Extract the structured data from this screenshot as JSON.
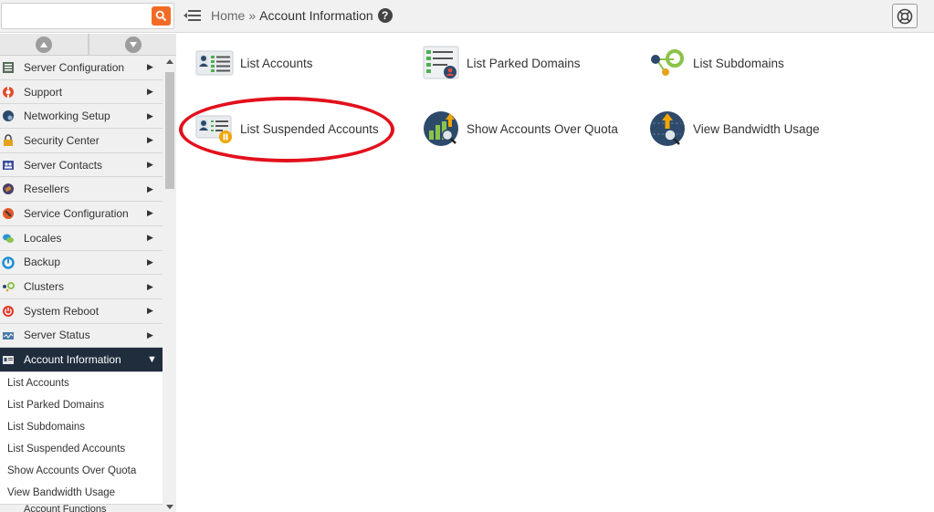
{
  "search": {
    "placeholder": "",
    "value": ""
  },
  "breadcrumb": {
    "home": "Home",
    "separator": "»",
    "current": "Account Information"
  },
  "sidebar": {
    "items": [
      {
        "label": "Server Configuration",
        "icon": "server-config-icon",
        "color": "#5a6a5a"
      },
      {
        "label": "Support",
        "icon": "lifebuoy-icon",
        "color": "#e34b2c"
      },
      {
        "label": "Networking Setup",
        "icon": "network-icon",
        "color": "#2e4a6b"
      },
      {
        "label": "Security Center",
        "icon": "lock-icon",
        "color": "#e5a21c"
      },
      {
        "label": "Server Contacts",
        "icon": "contacts-icon",
        "color": "#3d4fa0"
      },
      {
        "label": "Resellers",
        "icon": "tag-icon",
        "color": "#c9862c"
      },
      {
        "label": "Service Configuration",
        "icon": "wrench-icon",
        "color": "#e0582a"
      },
      {
        "label": "Locales",
        "icon": "speech-bubbles-icon",
        "color": "#2a98cf"
      },
      {
        "label": "Backup",
        "icon": "backup-icon",
        "color": "#1f8fd6"
      },
      {
        "label": "Clusters",
        "icon": "cluster-icon",
        "color": "#8bc34a"
      },
      {
        "label": "System Reboot",
        "icon": "power-icon",
        "color": "#e0392a"
      },
      {
        "label": "Server Status",
        "icon": "monitor-icon",
        "color": "#4a7aa8"
      },
      {
        "label": "Account Information",
        "icon": "account-info-icon",
        "color": "#ffffff"
      }
    ],
    "sub_items": [
      "List Accounts",
      "List Parked Domains",
      "List Subdomains",
      "List Suspended Accounts",
      "Show Accounts Over Quota",
      "View Bandwidth Usage"
    ],
    "next_item_peek": "Account Functions"
  },
  "tiles": [
    {
      "label": "List Accounts",
      "icon": "list-accounts-icon"
    },
    {
      "label": "List Parked Domains",
      "icon": "parked-domains-icon"
    },
    {
      "label": "List Subdomains",
      "icon": "subdomains-icon"
    },
    {
      "label": "List Suspended Accounts",
      "icon": "suspended-accounts-icon"
    },
    {
      "label": "Show Accounts Over Quota",
      "icon": "over-quota-icon"
    },
    {
      "label": "View Bandwidth Usage",
      "icon": "bandwidth-icon"
    }
  ],
  "colors": {
    "accent": "#f26b25",
    "active_nav": "#1f2d3d",
    "highlight": "#e3101c"
  }
}
